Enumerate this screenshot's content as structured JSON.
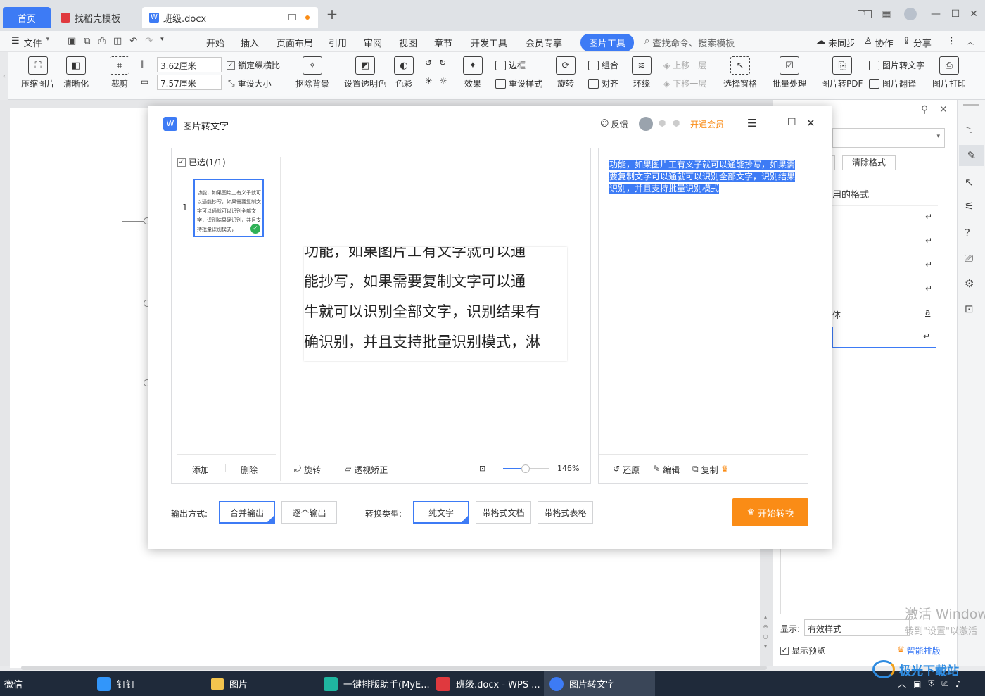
{
  "tabs": {
    "home": "首页",
    "template": "找稻壳模板",
    "doc": "班级.docx"
  },
  "menu": {
    "file": "文件",
    "items": [
      "开始",
      "插入",
      "页面布局",
      "引用",
      "审阅",
      "视图",
      "章节",
      "开发工具",
      "会员专享"
    ],
    "active": "图片工具",
    "search": "查找命令、搜索模板",
    "sync": "未同步",
    "collab": "协作",
    "share": "分享"
  },
  "ribbon": {
    "compress": "压缩图片",
    "sharpen": "清晰化",
    "crop": "裁剪",
    "height": "3.62厘米",
    "width": "7.57厘米",
    "lock_ratio": "锁定纵横比",
    "reset_size": "重设大小",
    "remove_bg": "抠除背景",
    "set_transparent": "设置透明色",
    "color": "色彩",
    "effect": "效果",
    "border": "边框",
    "reset_style": "重设样式",
    "rotate": "旋转",
    "group": "组合",
    "align": "对齐",
    "wrap": "环绕",
    "move_up": "上移一层",
    "move_down": "下移一层",
    "select_pane": "选择窗格",
    "batch": "批量处理",
    "to_pdf": "图片转PDF",
    "to_text": "图片转文字",
    "translate": "图片翻译",
    "print": "图片打印"
  },
  "dialog": {
    "title": "图片转文字",
    "feedback": "反馈",
    "vip": "开通会员",
    "selected": "已选(1/1)",
    "thumb_index": "1",
    "thumb_text": "功能，如果图片工有义子就可以通能抄写，如果需要复制文字可以通就可以识别全部文字，识别结果确识别，并且支持批量识别模式，",
    "add": "添加",
    "delete": "删除",
    "rotate": "旋转",
    "perspective": "透视矫正",
    "zoom": "146%",
    "preview_lines": [
      "功能，如果图片工有文字就可以通",
      "能抄写，如果需要复制文字可以通",
      "牛就可以识别全部文字，识别结果有",
      "确识别，并且支持批量识别模式，淋"
    ],
    "result_text": "功能，如果图片工有义子就可以通能抄写，如果需要复制文字可以通就可以识别全部文字，识别结果识别，并且支持批量识别模式",
    "restore": "还原",
    "edit": "编辑",
    "copy": "复制",
    "output_label": "输出方式:",
    "merge": "合并输出",
    "each": "逐个输出",
    "type_label": "转换类型:",
    "plain": "纯文字",
    "fmt_doc": "带格式文档",
    "fmt_table": "带格式表格",
    "start": "开始转换"
  },
  "rightpane": {
    "clear_format": "清除格式",
    "used_format": "用的格式",
    "style_body": "体",
    "style_a": "a",
    "show_label": "显示:",
    "show_value": "有效样式",
    "preview": "显示预览",
    "smart_layout": "智能排版"
  },
  "watermark": {
    "line1": "激活 Windows",
    "line2": "转到\"设置\"以激活",
    "logo": "极光下载站"
  },
  "taskbar": {
    "wechat": "微信",
    "dingtalk": "钉钉",
    "pictures": "图片",
    "myeditor": "一键排版助手(MyE...",
    "wps": "班级.docx - WPS ...",
    "img2text": "图片转文字"
  },
  "colors": {
    "accent": "#3d7bf5",
    "orange": "#fa8c16",
    "selection": "#3d7bf5"
  }
}
